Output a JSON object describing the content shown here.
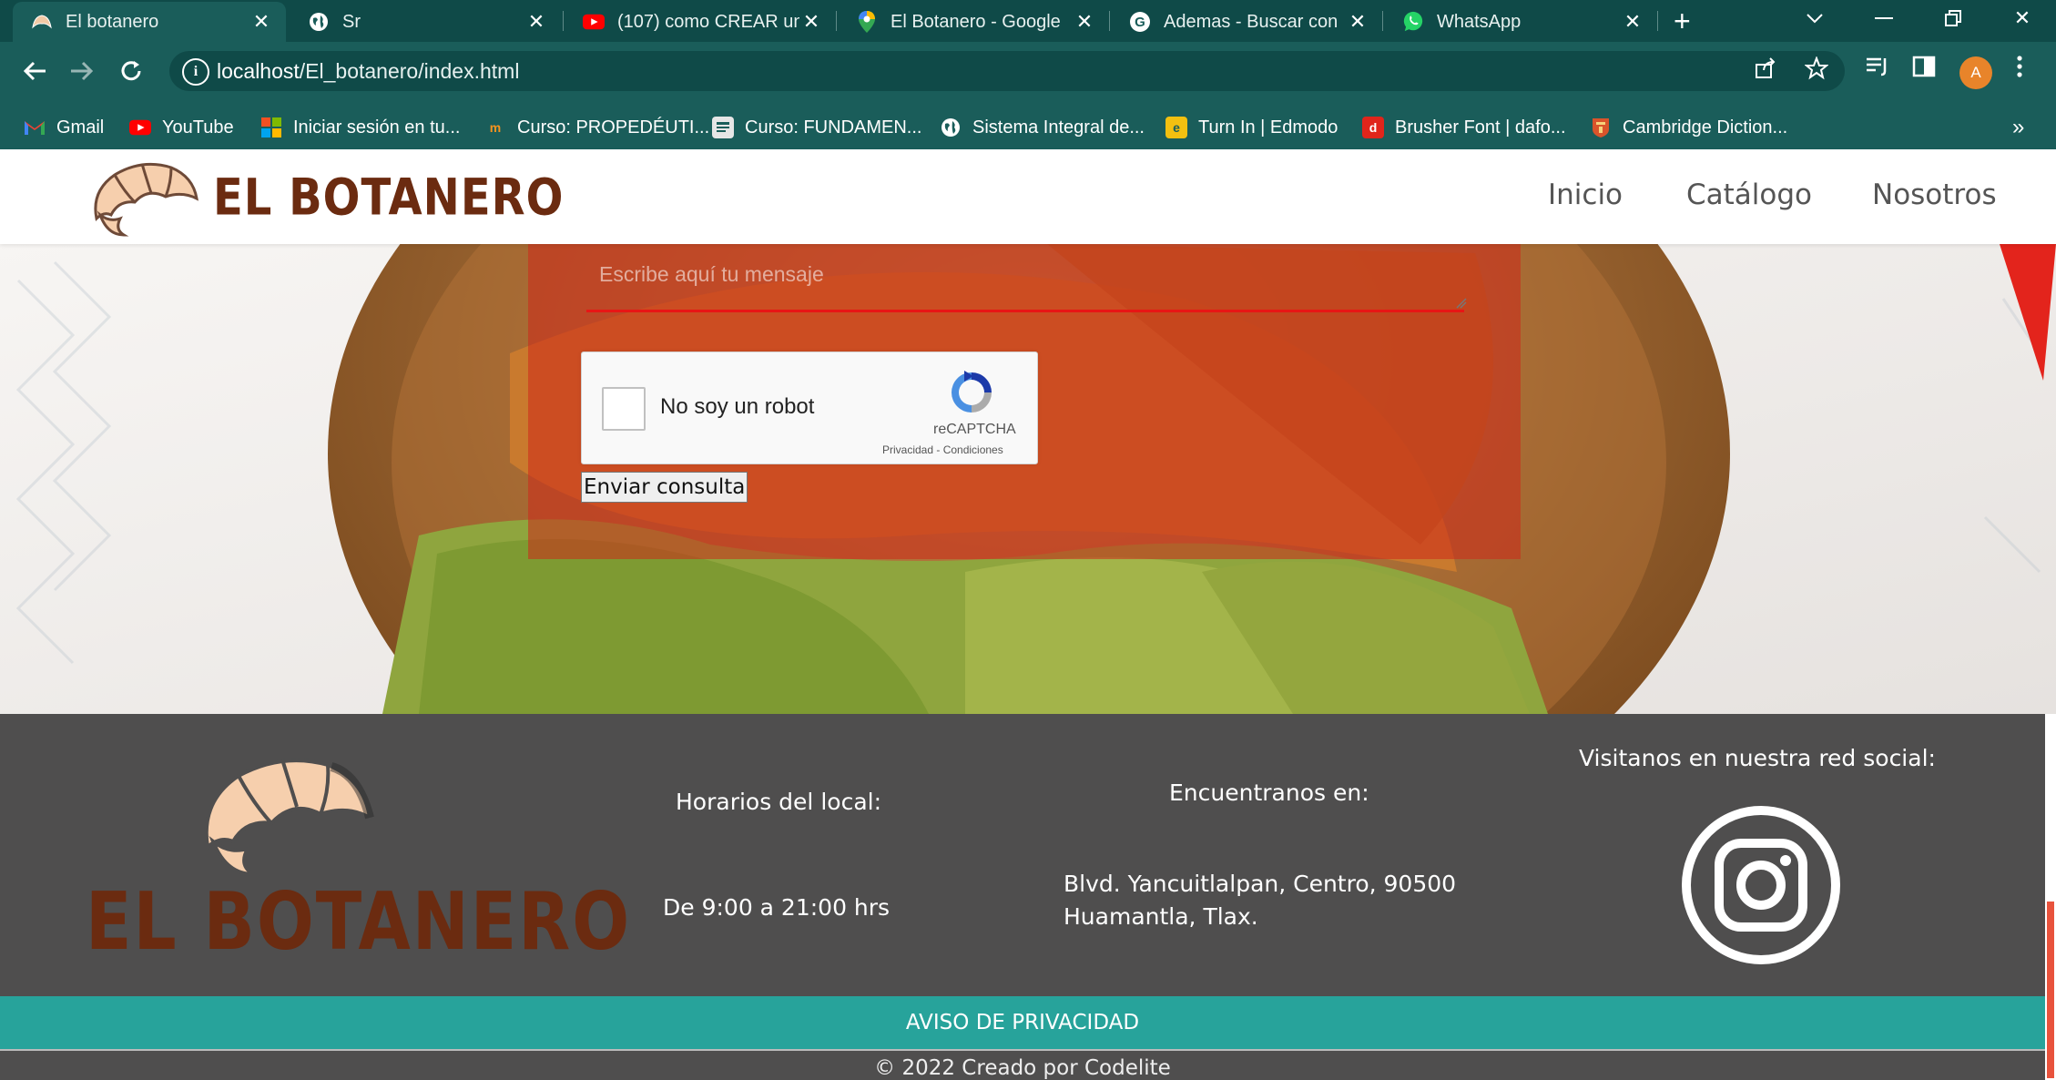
{
  "browser": {
    "tabs": [
      {
        "title": "El botanero",
        "icon": "croissant-favicon"
      },
      {
        "title": "Sr",
        "icon": "globe-icon"
      },
      {
        "title": "(107) como CREAR un",
        "icon": "youtube-icon"
      },
      {
        "title": "El Botanero - Google",
        "icon": "maps-pin-icon"
      },
      {
        "title": "Ademas - Buscar con",
        "icon": "google-icon"
      },
      {
        "title": "WhatsApp",
        "icon": "whatsapp-icon"
      }
    ],
    "url_host": "localhost",
    "url_path": "/El_botanero/index.html",
    "avatar_letter": "A",
    "bookmarks": [
      {
        "label": "Gmail",
        "icon": "gmail-icon"
      },
      {
        "label": "YouTube",
        "icon": "youtube-icon"
      },
      {
        "label": "Iniciar sesión en tu...",
        "icon": "microsoft-icon"
      },
      {
        "label": "Curso: PROPEDÉUTI...",
        "icon": "moodle-icon"
      },
      {
        "label": "Curso: FUNDAMEN...",
        "icon": "course-icon"
      },
      {
        "label": "Sistema Integral de...",
        "icon": "globe-icon"
      },
      {
        "label": "Turn In | Edmodo",
        "icon": "edmodo-icon"
      },
      {
        "label": "Brusher Font | dafo...",
        "icon": "dafont-icon"
      },
      {
        "label": "Cambridge Diction...",
        "icon": "cambridge-icon"
      }
    ],
    "bookmarks_more": "»"
  },
  "header": {
    "logo_text": "EL BOTANERO",
    "nav": [
      "Inicio",
      "Catálogo",
      "Nosotros"
    ]
  },
  "form": {
    "message_placeholder": "Escribe aquí tu mensaje",
    "captcha_label": "No soy un robot",
    "captcha_brand": "reCAPTCHA",
    "captcha_terms": "Privacidad - Condiciones",
    "submit_label": "Enviar consulta"
  },
  "footer": {
    "logo_text": "EL BOTANERO",
    "hours_title": "Horarios del local:",
    "hours_value": "De 9:00 a 21:00 hrs",
    "location_title": "Encuentranos en:",
    "address_line1": "Blvd. Yancuitlalpan, Centro, 90500",
    "address_line2": "Huamantla, Tlax.",
    "social_title": "Visitanos en nuestra red social:",
    "social_icon": "instagram-icon",
    "privacy_label": "AVISO DE PRIVACIDAD",
    "copyright": "© 2022 Creado por Codelite"
  },
  "colors": {
    "brand_brown": "#6b2b10",
    "teal": "#27a39b",
    "chrome_dark": "#0f4a48",
    "chrome": "#1a5d5a",
    "footer_gray": "#4f4e4e",
    "form_overlay": "#cd2819"
  }
}
